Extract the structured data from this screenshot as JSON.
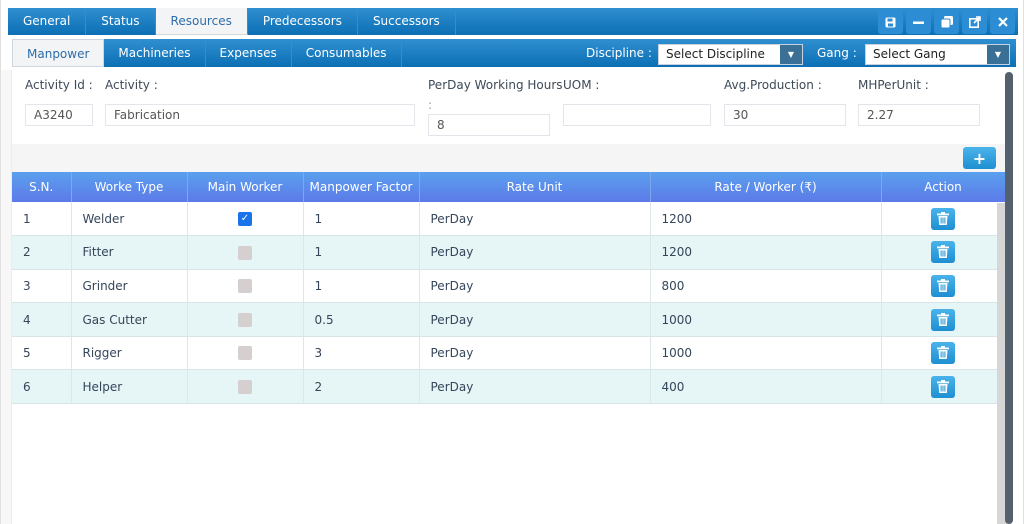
{
  "tabs": [
    {
      "label": "General",
      "active": false
    },
    {
      "label": "Status",
      "active": false
    },
    {
      "label": "Resources",
      "active": true
    },
    {
      "label": "Predecessors",
      "active": false
    },
    {
      "label": "Successors",
      "active": false
    }
  ],
  "window_buttons": [
    {
      "name": "save-icon",
      "glyph": "🖫"
    },
    {
      "name": "minimize-icon",
      "glyph": "—"
    },
    {
      "name": "restore-icon",
      "glyph": "❐"
    },
    {
      "name": "popout-icon",
      "glyph": "⇱"
    },
    {
      "name": "close-icon",
      "glyph": "✕"
    }
  ],
  "subtabs": [
    {
      "label": "Manpower",
      "active": true
    },
    {
      "label": "Machineries",
      "active": false
    },
    {
      "label": "Expenses",
      "active": false
    },
    {
      "label": "Consumables",
      "active": false
    }
  ],
  "filters": {
    "discipline_label": "Discipline :",
    "discipline_value": "Select Discipline",
    "gang_label": "Gang :",
    "gang_value": "Select Gang"
  },
  "form": {
    "activity_id_label": "Activity Id :",
    "activity_id_value": "A3240",
    "activity_label": "Activity :",
    "activity_value": "Fabrication",
    "perday_label": "PerDay Working Hours",
    "perday_label_suffix": ":",
    "perday_value": "8",
    "uom_label": "UOM :",
    "uom_value": "",
    "avg_production_label": "Avg.Production :",
    "avg_production_value": "30",
    "mh_per_unit_label": "MHPerUnit :",
    "mh_per_unit_value": "2.27"
  },
  "add_button": "+",
  "table": {
    "columns": [
      "S.N.",
      "Worke Type",
      "Main Worker",
      "Manpower Factor",
      "Rate Unit",
      "Rate / Worker (₹)",
      "Action"
    ],
    "rows": [
      {
        "sn": "1",
        "type": "Welder",
        "main": true,
        "factor": "1",
        "unit": "PerDay",
        "rate": "1200"
      },
      {
        "sn": "2",
        "type": "Fitter",
        "main": false,
        "factor": "1",
        "unit": "PerDay",
        "rate": "1200"
      },
      {
        "sn": "3",
        "type": "Grinder",
        "main": false,
        "factor": "1",
        "unit": "PerDay",
        "rate": "800"
      },
      {
        "sn": "4",
        "type": "Gas Cutter",
        "main": false,
        "factor": "0.5",
        "unit": "PerDay",
        "rate": "1000"
      },
      {
        "sn": "5",
        "type": "Rigger",
        "main": false,
        "factor": "3",
        "unit": "PerDay",
        "rate": "1000"
      },
      {
        "sn": "6",
        "type": "Helper",
        "main": false,
        "factor": "2",
        "unit": "PerDay",
        "rate": "400"
      }
    ]
  },
  "colors": {
    "tab_bar": "#0c6fb5",
    "header_gradient_start": "#5aa0ee",
    "header_gradient_end": "#5d7ae8",
    "alt_row": "#e6f5f6",
    "action_button": "#1e8fd2",
    "checked": "#1a73e8"
  }
}
